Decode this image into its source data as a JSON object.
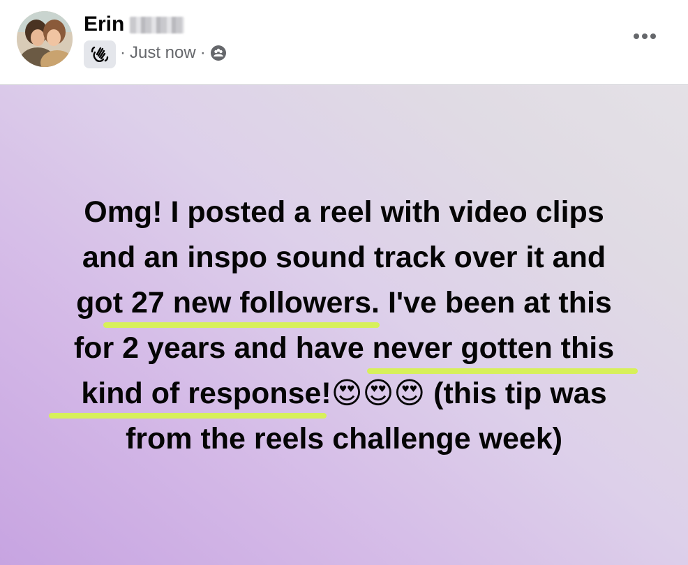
{
  "post": {
    "author": {
      "name": "Erin"
    },
    "meta": {
      "separator_1": "·",
      "time": "Just now",
      "separator_2": "·"
    },
    "icons": {
      "badge": "waving-hand-icon",
      "audience": "group-icon",
      "more": "more-options-icon"
    },
    "text_lines": [
      "Omg! I posted a reel with video clips",
      "and an inspo sound track over it and",
      "got 27 new followers. I've been at this",
      "for 2 years and have never gotten this",
      "kind of response!😍😍😍 (this tip was",
      "from the reels challenge week)"
    ],
    "highlighted_phrases": [
      "27 new followers.",
      "never gotten this",
      "kind of response!"
    ],
    "colors": {
      "highlight": "#d7f05a",
      "background_start": "#c7a4e1",
      "background_end": "#e4e1e6",
      "text": "#050505",
      "meta_text": "#65676b"
    }
  }
}
